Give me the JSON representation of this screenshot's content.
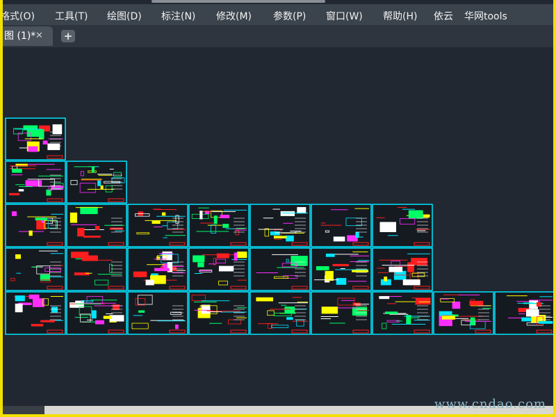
{
  "menu": {
    "items": [
      {
        "id": "format",
        "label": "格式(O)"
      },
      {
        "id": "tools",
        "label": "工具(T)"
      },
      {
        "id": "draw",
        "label": "绘图(D)"
      },
      {
        "id": "dimension",
        "label": "标注(N)"
      },
      {
        "id": "modify",
        "label": "修改(M)"
      },
      {
        "id": "parametric",
        "label": "参数(P)"
      },
      {
        "id": "window",
        "label": "窗口(W)"
      },
      {
        "id": "help",
        "label": "帮助(H)"
      },
      {
        "id": "yiyun",
        "label": "依云"
      },
      {
        "id": "huawang",
        "label": "华网tools"
      }
    ]
  },
  "tabs": {
    "active_label": "图 (1)*",
    "close_glyph": "✕",
    "add_glyph": "+"
  },
  "colors": {
    "background": "#212832",
    "sheet_border": "#00e5ff",
    "accent_yellow": "#ffff00",
    "accent_red": "#ff1e1e",
    "accent_magenta": "#ff2dff",
    "accent_green": "#00ff66",
    "frame": "#f2e000"
  },
  "watermark": "www.cndao.com"
}
